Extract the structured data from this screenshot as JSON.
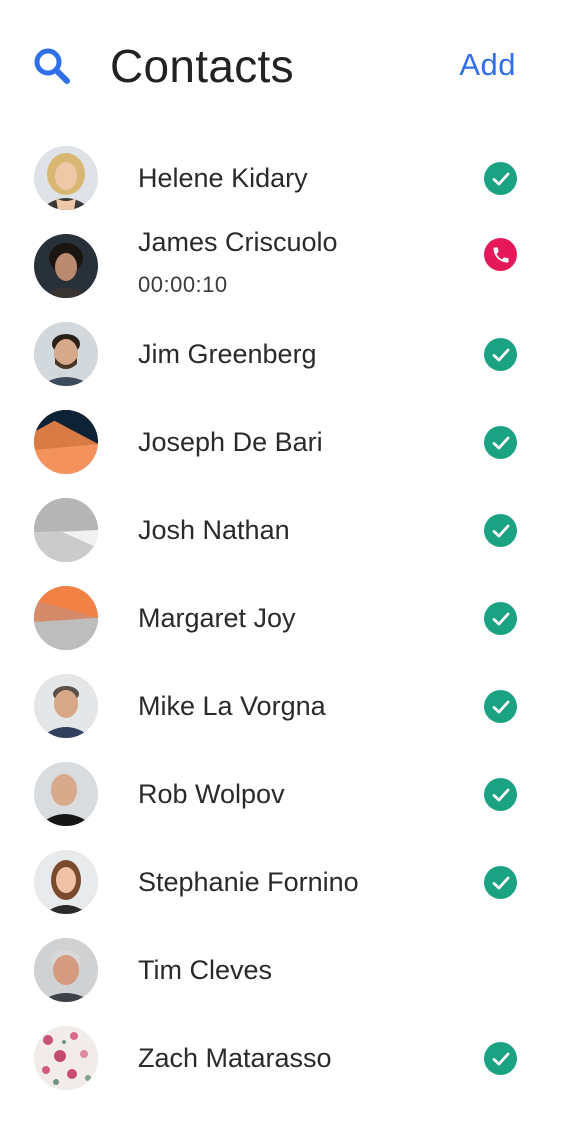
{
  "header": {
    "title": "Contacts",
    "add_label": "Add",
    "search_icon": "search-icon"
  },
  "colors": {
    "accent": "#2f6fe8",
    "status_ok": "#1aa283",
    "status_call": "#e5195a"
  },
  "contacts": [
    {
      "name": "Helene Kidary",
      "status": "available",
      "avatar": "photo-blonde-woman"
    },
    {
      "name": "James Criscuolo",
      "sub": "00:00:10",
      "status": "on-call",
      "avatar": "photo-dark-hair-man"
    },
    {
      "name": "Jim Greenberg",
      "status": "available",
      "avatar": "photo-bearded-man"
    },
    {
      "name": "Joseph De Bari",
      "status": "available",
      "avatar": "placeholder-navy-orange"
    },
    {
      "name": "Josh Nathan",
      "status": "available",
      "avatar": "placeholder-grey"
    },
    {
      "name": "Margaret Joy",
      "status": "available",
      "avatar": "placeholder-orange-grey"
    },
    {
      "name": "Mike La Vorgna",
      "status": "available",
      "avatar": "photo-man-smiling"
    },
    {
      "name": "Rob Wolpov",
      "status": "available",
      "avatar": "photo-bald-man"
    },
    {
      "name": "Stephanie Fornino",
      "status": "available",
      "avatar": "photo-brunette-woman"
    },
    {
      "name": "Tim Cleves",
      "status": "none",
      "avatar": "photo-grey-hair-man"
    },
    {
      "name": "Zach Matarasso",
      "status": "available",
      "avatar": "floral-pattern"
    }
  ]
}
